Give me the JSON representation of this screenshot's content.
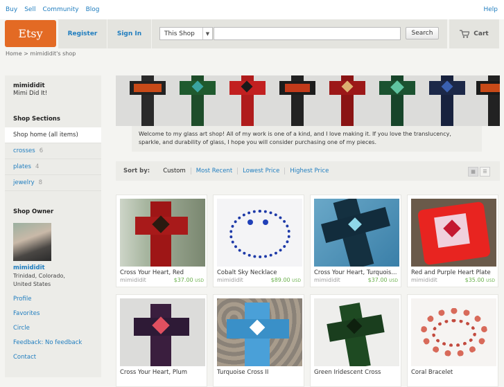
{
  "topnav": {
    "items": [
      "Buy",
      "Sell",
      "Community",
      "Blog"
    ],
    "help": "Help"
  },
  "header": {
    "logo": "Etsy",
    "register": "Register",
    "signin": "Sign In",
    "scope": "This Shop",
    "search_value": "",
    "search_button": "Search",
    "cart": "Cart"
  },
  "breadcrumb": "Home > mimididit's shop",
  "sidebar": {
    "shop_name": "mimididit",
    "tagline": "Mimi Did It!",
    "sections_heading": "Shop Sections",
    "sections": [
      {
        "label": "Shop home (all items)",
        "count": ""
      },
      {
        "label": "crosses",
        "count": "6"
      },
      {
        "label": "plates",
        "count": "4"
      },
      {
        "label": "jewelry",
        "count": "8"
      }
    ],
    "owner_heading": "Shop Owner",
    "owner_name": "mimididit",
    "owner_location": "Trinidad, Colorado, United States",
    "links": [
      "Profile",
      "Favorites",
      "Circle",
      "Feedback: No feedback",
      "Contact"
    ]
  },
  "welcome": "Welcome to my glass art shop! All of my work is one of a kind, and I love making it. If you love the translucency, sparkle, and durability of glass, I hope you will consider purchasing one of my pieces.",
  "sort": {
    "label": "Sort by:",
    "options": [
      "Custom",
      "Most Recent",
      "Lowest Price",
      "Highest Price"
    ]
  },
  "listings": [
    {
      "title": "Cross Your Heart, Red",
      "shop": "mimididit",
      "price": "$37.00",
      "currency": "USD"
    },
    {
      "title": "Cobalt Sky Necklace",
      "shop": "mimididit",
      "price": "$89.00",
      "currency": "USD"
    },
    {
      "title": "Cross Your Heart, Turquois...",
      "shop": "mimididit",
      "price": "$37.00",
      "currency": "USD"
    },
    {
      "title": "Red and Purple Heart Plate",
      "shop": "mimididit",
      "price": "$35.00",
      "currency": "USD"
    },
    {
      "title": "Cross Your Heart, Plum",
      "shop": "",
      "price": "",
      "currency": ""
    },
    {
      "title": "Turquoise Cross II",
      "shop": "",
      "price": "",
      "currency": ""
    },
    {
      "title": "Green Iridescent Cross",
      "shop": "",
      "price": "",
      "currency": ""
    },
    {
      "title": "Coral Bracelet",
      "shop": "",
      "price": "",
      "currency": ""
    }
  ],
  "colors": {
    "brand": "#e36a24",
    "link": "#1f7dbf",
    "price": "#6ab04c"
  }
}
